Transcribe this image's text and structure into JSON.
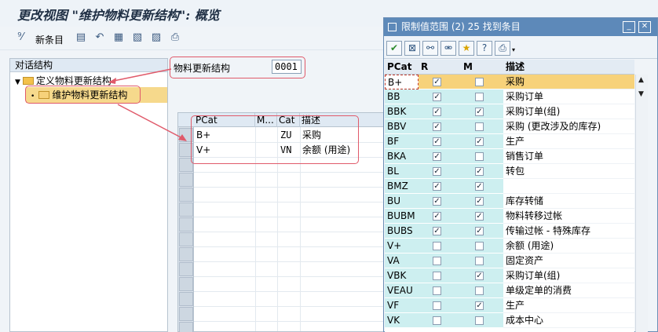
{
  "window": {
    "title": "更改视图 \"维护物料更新结构\": 概览"
  },
  "toolbar": {
    "new_entries_label": "新条目",
    "icons": [
      "glasses-icon",
      "copy-rows-icon",
      "undo-icon",
      "select-all-icon",
      "select-block-icon",
      "deselect-icon",
      "print-icon"
    ]
  },
  "tree": {
    "header": "对话结构",
    "items": [
      {
        "label": "定义物料更新结构"
      },
      {
        "label": "维护物料更新结构"
      }
    ]
  },
  "field": {
    "label": "物料更新结构",
    "value": "0001"
  },
  "grid": {
    "columns": [
      "PCat",
      "M...",
      "Cat",
      "描述"
    ],
    "rows": [
      {
        "pcat": "B+",
        "m": "",
        "cat": "ZU",
        "desc": "采购"
      },
      {
        "pcat": "V+",
        "m": "",
        "cat": "VN",
        "desc": "余额 (用途)"
      }
    ]
  },
  "dialog": {
    "title": "限制值范围 (2)   25 找到条目",
    "tool_icons": [
      "checkmark-icon",
      "close-box-icon",
      "binoculars-icon",
      "binoculars-plus-icon",
      "star-add-icon",
      "help-icon",
      "printer-icon"
    ],
    "columns": [
      "PCat",
      "R",
      "M",
      "描述"
    ],
    "rows": [
      {
        "pcat": "B+",
        "r": true,
        "m": false,
        "desc": "采购"
      },
      {
        "pcat": "BB",
        "r": true,
        "m": false,
        "desc": "采购订单"
      },
      {
        "pcat": "BBK",
        "r": true,
        "m": true,
        "desc": "采购订单(组)"
      },
      {
        "pcat": "BBV",
        "r": true,
        "m": false,
        "desc": "采购 (更改涉及的库存)"
      },
      {
        "pcat": "BF",
        "r": true,
        "m": true,
        "desc": "生产"
      },
      {
        "pcat": "BKA",
        "r": true,
        "m": false,
        "desc": "销售订单"
      },
      {
        "pcat": "BL",
        "r": true,
        "m": true,
        "desc": "转包"
      },
      {
        "pcat": "BMZ",
        "r": true,
        "m": true,
        "desc": ""
      },
      {
        "pcat": "BU",
        "r": true,
        "m": true,
        "desc": "库存转储"
      },
      {
        "pcat": "BUBM",
        "r": true,
        "m": true,
        "desc": "物料转移过帐"
      },
      {
        "pcat": "BUBS",
        "r": true,
        "m": true,
        "desc": "传输过帐 - 特殊库存"
      },
      {
        "pcat": "V+",
        "r": false,
        "m": false,
        "desc": "余额 (用途)"
      },
      {
        "pcat": "VA",
        "r": false,
        "m": false,
        "desc": "固定资产"
      },
      {
        "pcat": "VBK",
        "r": false,
        "m": true,
        "desc": "采购订单(组)"
      },
      {
        "pcat": "VEAU",
        "r": false,
        "m": false,
        "desc": "单级定单的消费"
      },
      {
        "pcat": "VF",
        "r": false,
        "m": true,
        "desc": "生产"
      },
      {
        "pcat": "VK",
        "r": false,
        "m": false,
        "desc": "成本中心"
      }
    ]
  }
}
